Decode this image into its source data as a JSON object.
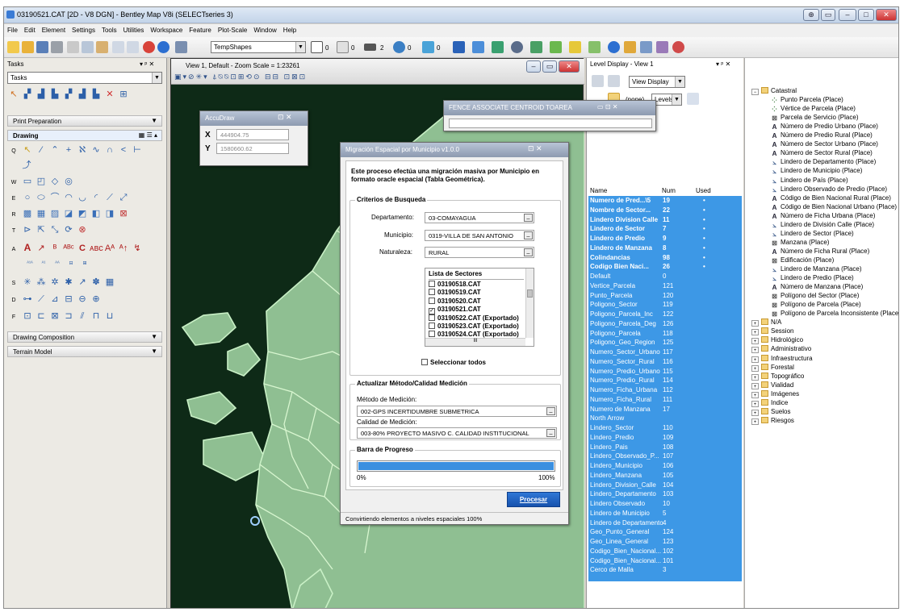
{
  "window": {
    "title": "03190521.CAT [2D - V8 DGN] - Bentley Map V8i (SELECTseries 3)"
  },
  "menu": [
    "File",
    "Edit",
    "Element",
    "Settings",
    "Tools",
    "Utilities",
    "Workspace",
    "Feature",
    "Plot-Scale",
    "Window",
    "Help"
  ],
  "toolbar": {
    "temp_shapes": "TempShapes",
    "weight_a": "0",
    "weight_b": "0",
    "weight_c": "2",
    "weight_d": "0",
    "weight_e": "0"
  },
  "tasks": {
    "header": "Tasks",
    "combo": "Tasks",
    "print_prep": "Print Preparation",
    "drawing": "Drawing",
    "drawing_composition": "Drawing Composition",
    "terrain_model": "Terrain Model",
    "row_keys": [
      "Q",
      "W",
      "E",
      "R",
      "T",
      "A",
      "S",
      "D",
      "F"
    ]
  },
  "view": {
    "title": "View 1, Default - Zoom Scale = 1:23261"
  },
  "accudraw": {
    "title": "AccuDraw",
    "x_label": "X",
    "x_value": "444904.75",
    "y_label": "Y",
    "y_value": "1580660.62"
  },
  "fence": {
    "title": "FENCE ASSOCIATE CENTROID TOAREA"
  },
  "migracion": {
    "title": "Migración Espacial por Municipio v1.0.0",
    "intro": "Este proceso efectúa una migración masiva por Municipio en formato oracle espacial (Tabla Geométrica).",
    "criterios_title": "Criterios de Busqueda",
    "departamento_label": "Departamento:",
    "departamento_value": "03-COMAYAGUA",
    "municipio_label": "Municipio:",
    "municipio_value": "0319-VILLA DE SAN ANTONIO",
    "naturaleza_label": "Naturaleza:",
    "naturaleza_value": "RURAL",
    "sectores_header": "Lista de Sectores",
    "sectores": [
      {
        "name": "03190518.CAT",
        "checked": false
      },
      {
        "name": "03190519.CAT",
        "checked": false
      },
      {
        "name": "03190520.CAT",
        "checked": false
      },
      {
        "name": "03190521.CAT",
        "checked": true
      },
      {
        "name": "03190522.CAT (Exportado)",
        "checked": false
      },
      {
        "name": "03190523.CAT (Exportado)",
        "checked": false
      },
      {
        "name": "03190524.CAT (Exportado)",
        "checked": false
      }
    ],
    "scroll_label": "III",
    "seleccionar_todos": "Seleccionar todos",
    "actualizar_title": "Actualizar Método/Calidad Medición",
    "metodo_label": "Método de Medición:",
    "metodo_value": "002-GPS INCERTIDUMBRE SUBMETRICA",
    "calidad_label": "Calidad de Medición:",
    "calidad_value": "003-80% PROYECTO MASIVO C. CALIDAD INSTITUCIONAL",
    "progreso_title": "Barra de Progreso",
    "progress_value": 1.0,
    "progress_min_label": "0%",
    "progress_max_label": "100%",
    "procesar_label": "Procesar",
    "status": "Convirtiendo elementos a niveles espaciales  100%"
  },
  "level_display": {
    "title": "Level Display - View 1",
    "view_display": "View Display",
    "none_label": "(none)",
    "levels_label": "Levels",
    "columns": {
      "name": "Name",
      "num": "Num",
      "used": "Used"
    },
    "rows": [
      {
        "name": "Numero de Pred...\\5",
        "num": "19",
        "used": "•",
        "bold": true
      },
      {
        "name": "Nombre de Sector...",
        "num": "22",
        "used": "•",
        "bold": true
      },
      {
        "name": "Lindero Division Calle",
        "num": "11",
        "used": "•",
        "bold": true
      },
      {
        "name": "Lindero de Sector",
        "num": "7",
        "used": "•",
        "bold": true
      },
      {
        "name": "Lindero de Predio",
        "num": "9",
        "used": "•",
        "bold": true
      },
      {
        "name": "Lindero de Manzana",
        "num": "8",
        "used": "•",
        "bold": true
      },
      {
        "name": "Colindancias",
        "num": "98",
        "used": "•",
        "bold": true
      },
      {
        "name": "Codigo Bien Naci...",
        "num": "26",
        "used": "•",
        "bold": true
      },
      {
        "name": "Default",
        "num": "0",
        "used": ""
      },
      {
        "name": "Vertice_Parcela",
        "num": "121",
        "used": ""
      },
      {
        "name": "Punto_Parcela",
        "num": "120",
        "used": ""
      },
      {
        "name": "Poligono_Sector",
        "num": "119",
        "used": ""
      },
      {
        "name": "Poligono_Parcela_Inc",
        "num": "122",
        "used": ""
      },
      {
        "name": "Poligono_Parcela_Deg",
        "num": "126",
        "used": ""
      },
      {
        "name": "Poligono_Parcela",
        "num": "118",
        "used": ""
      },
      {
        "name": "Poligono_Geo_Region",
        "num": "125",
        "used": ""
      },
      {
        "name": "Numero_Sector_Urbano",
        "num": "117",
        "used": ""
      },
      {
        "name": "Numero_Sector_Rural",
        "num": "116",
        "used": ""
      },
      {
        "name": "Numero_Predio_Urbano",
        "num": "115",
        "used": ""
      },
      {
        "name": "Numero_Predio_Rural",
        "num": "114",
        "used": ""
      },
      {
        "name": "Numero_Ficha_Urbana",
        "num": "112",
        "used": ""
      },
      {
        "name": "Numero_Ficha_Rural",
        "num": "111",
        "used": ""
      },
      {
        "name": "Numero de Manzana",
        "num": "17",
        "used": ""
      },
      {
        "name": "North Arrow",
        "num": "",
        "used": ""
      },
      {
        "name": "Lindero_Sector",
        "num": "110",
        "used": ""
      },
      {
        "name": "Lindero_Predio",
        "num": "109",
        "used": ""
      },
      {
        "name": "Lindero_Pais",
        "num": "108",
        "used": ""
      },
      {
        "name": "Lindero_Observado_P...",
        "num": "107",
        "used": ""
      },
      {
        "name": "Lindero_Municipio",
        "num": "106",
        "used": ""
      },
      {
        "name": "Lindero_Manzana",
        "num": "105",
        "used": ""
      },
      {
        "name": "Lindero_Division_Calle",
        "num": "104",
        "used": ""
      },
      {
        "name": "Lindero_Departamento",
        "num": "103",
        "used": ""
      },
      {
        "name": "Lindero Observado",
        "num": "10",
        "used": ""
      },
      {
        "name": "Lindero de Municipio",
        "num": "5",
        "used": ""
      },
      {
        "name": "Lindero de Departamento",
        "num": "4",
        "used": ""
      },
      {
        "name": "Geo_Punto_General",
        "num": "124",
        "used": ""
      },
      {
        "name": "Geo_Linea_General",
        "num": "123",
        "used": ""
      },
      {
        "name": "Codigo_Bien_Nacional...",
        "num": "102",
        "used": ""
      },
      {
        "name": "Codigo_Bien_Nacional...",
        "num": "101",
        "used": ""
      },
      {
        "name": "Cerco de Malla",
        "num": "3",
        "used": ""
      }
    ]
  },
  "tree": {
    "root": "Catastral",
    "children": [
      {
        "label": "Punto Parcela (Place)",
        "icon": "dots"
      },
      {
        "label": "Vértice de Parcela (Place)",
        "icon": "dots"
      },
      {
        "label": "Parcela de Servicio (Place)",
        "icon": "box"
      },
      {
        "label": "Número de Predio Urbano (Place)",
        "icon": "A"
      },
      {
        "label": "Número de Predio Rural (Place)",
        "icon": "A"
      },
      {
        "label": "Número de Sector Urbano (Place)",
        "icon": "A"
      },
      {
        "label": "Número de Sector Rural (Place)",
        "icon": "A"
      },
      {
        "label": "Lindero de Departamento (Place)",
        "icon": "line"
      },
      {
        "label": "Lindero de Municipio (Place)",
        "icon": "line"
      },
      {
        "label": "Lindero de País (Place)",
        "icon": "line"
      },
      {
        "label": "Lindero Observado de Predio (Place)",
        "icon": "line"
      },
      {
        "label": "Código de Bien Nacional Rural (Place)",
        "icon": "A"
      },
      {
        "label": "Código de Bien Nacional Urbano (Place)",
        "icon": "A"
      },
      {
        "label": "Número de Ficha Urbana (Place)",
        "icon": "A"
      },
      {
        "label": "Lindero de División Calle (Place)",
        "icon": "line"
      },
      {
        "label": "Lindero de Sector (Place)",
        "icon": "line"
      },
      {
        "label": "Manzana (Place)",
        "icon": "box"
      },
      {
        "label": "Número de Ficha Rural (Place)",
        "icon": "A"
      },
      {
        "label": "Edificación (Place)",
        "icon": "box"
      },
      {
        "label": "Lindero de Manzana (Place)",
        "icon": "line"
      },
      {
        "label": "Lindero de Predio (Place)",
        "icon": "line"
      },
      {
        "label": "Número de Manzana (Place)",
        "icon": "A"
      },
      {
        "label": "Polígono del Sector (Place)",
        "icon": "box"
      },
      {
        "label": "Polígono de Parcela (Place)",
        "icon": "box"
      },
      {
        "label": "Polígono de Parcela Inconsistente (Place)",
        "icon": "box"
      }
    ],
    "folders": [
      "N/A",
      "Session",
      "Hidrológico",
      "Administrativo",
      "Infraestructura",
      "Forestal",
      "Topográfico",
      "Vialidad",
      "Imágenes",
      "Indice",
      "Suelos",
      "Riesgos"
    ]
  }
}
